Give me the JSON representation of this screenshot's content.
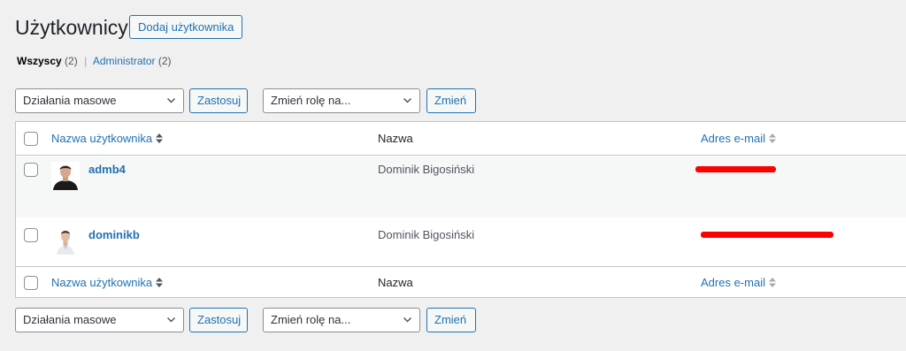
{
  "page": {
    "title": "Użytkownicy",
    "add_new_label": "Dodaj użytkownika"
  },
  "views": {
    "all_label": "Wszyscy",
    "all_count": "(2)",
    "separator": "|",
    "admin_label": "Administrator",
    "admin_count": "(2)"
  },
  "bulk_actions": {
    "select_value": "Działania masowe",
    "apply_label": "Zastosuj"
  },
  "change_role": {
    "select_value": "Zmień rolę na...",
    "apply_label": "Zmień"
  },
  "table": {
    "columns": {
      "username": "Nazwa użytkownika",
      "name": "Nazwa",
      "email": "Adres e-mail"
    },
    "rows": [
      {
        "username": "admb4",
        "name": "Dominik Bigosiński",
        "email_redacted": true
      },
      {
        "username": "dominikb",
        "name": "Dominik Bigosiński",
        "email_redacted": true
      }
    ]
  },
  "colors": {
    "accent": "#2271b1",
    "background": "#f0f0f1",
    "redaction": "#ff0000"
  }
}
